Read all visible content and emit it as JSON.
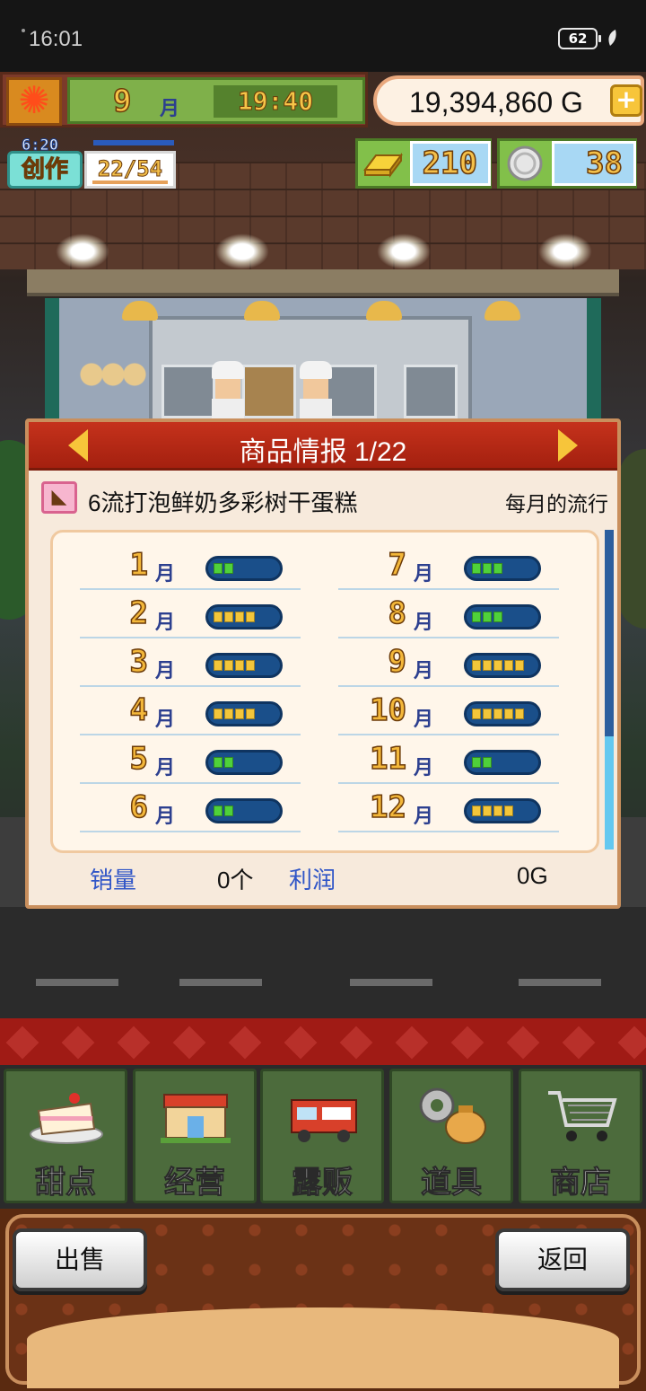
{
  "status_bar": {
    "time": "16:01",
    "battery": "62"
  },
  "hud": {
    "month_number": "9",
    "month_unit": "月",
    "clock": "19:40",
    "money": "19,394,860 G",
    "money_plus_label": "+",
    "create_timer": "6:20",
    "create_label": "创作",
    "create_count": "22/54",
    "gold_count": "210",
    "coin_count": "38"
  },
  "panel": {
    "title": "商品情报 1/22",
    "product_name": "6流打泡鲜奶多彩树干蛋糕",
    "trend_label": "每月的流行",
    "month_unit": "月",
    "months": [
      {
        "num": "1",
        "level": 2,
        "color": "green"
      },
      {
        "num": "2",
        "level": 4,
        "color": "yellow"
      },
      {
        "num": "3",
        "level": 4,
        "color": "yellow"
      },
      {
        "num": "4",
        "level": 4,
        "color": "yellow"
      },
      {
        "num": "5",
        "level": 2,
        "color": "green"
      },
      {
        "num": "6",
        "level": 2,
        "color": "green"
      },
      {
        "num": "7",
        "level": 3,
        "color": "green"
      },
      {
        "num": "8",
        "level": 3,
        "color": "green"
      },
      {
        "num": "9",
        "level": 5,
        "color": "yellow"
      },
      {
        "num": "10",
        "level": 5,
        "color": "yellow"
      },
      {
        "num": "11",
        "level": 2,
        "color": "green"
      },
      {
        "num": "12",
        "level": 4,
        "color": "yellow"
      }
    ],
    "sales_label": "销量",
    "sales_value": "0个",
    "profit_label": "利润",
    "profit_value": "0G"
  },
  "menu": {
    "items": [
      {
        "label": "甜点",
        "icon": "cake-icon"
      },
      {
        "label": "经营",
        "icon": "shop-icon"
      },
      {
        "label": "露贩",
        "icon": "food-truck-icon"
      },
      {
        "label": "道具",
        "icon": "items-bag-icon"
      },
      {
        "label": "商店",
        "icon": "cart-icon"
      }
    ]
  },
  "bottom": {
    "sell_label": "出售",
    "back_label": "返回"
  },
  "colors": {
    "gauge_green": "#4fd13a",
    "gauge_yellow": "#f3c63a",
    "panel_header": "#c5321c",
    "stat_label": "#2f55c7"
  }
}
